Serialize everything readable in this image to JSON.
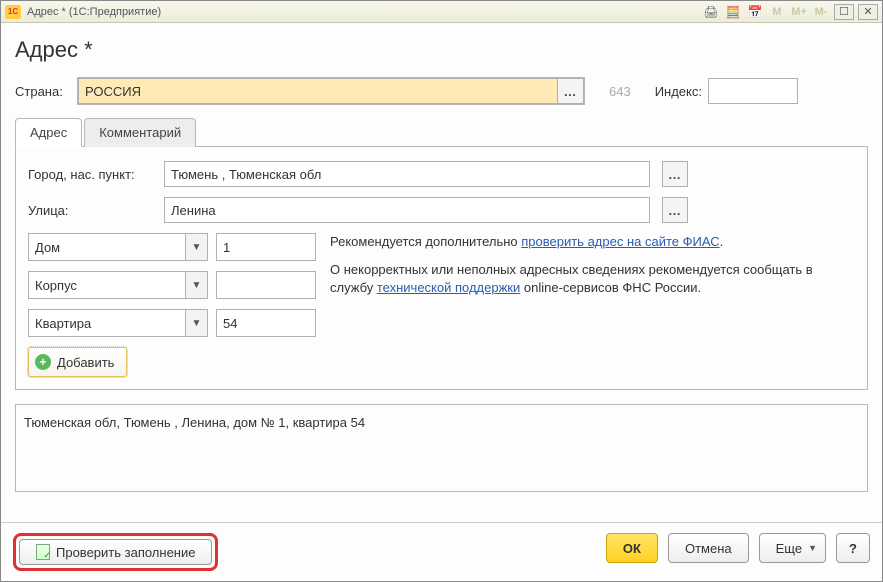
{
  "titlebar": {
    "title": "Адрес * (1С:Предприятие)",
    "logo": "1C"
  },
  "page_title": "Адрес *",
  "country": {
    "label": "Страна:",
    "value": "РОССИЯ",
    "code": "643",
    "index_label": "Индекс:",
    "index_value": ""
  },
  "tabs": {
    "address": "Адрес",
    "comment": "Комментарий"
  },
  "address": {
    "city_label": "Город, нас. пункт:",
    "city_value": "Тюмень , Тюменская обл",
    "street_label": "Улица:",
    "street_value": "Ленина",
    "parts": [
      {
        "type": "Дом",
        "value": "1"
      },
      {
        "type": "Корпус",
        "value": ""
      },
      {
        "type": "Квартира",
        "value": "54"
      }
    ],
    "hint1_pre": "Рекомендуется дополнительно ",
    "hint1_link": "проверить адрес на сайте ФИАС",
    "hint1_post": ".",
    "hint2_pre": "О некорректных или неполных адресных сведениях рекомендуется сообщать в службу ",
    "hint2_link": "технической поддержки",
    "hint2_post": " online-сервисов ФНС России.",
    "add_label": "Добавить"
  },
  "summary": "Тюменская обл, Тюмень , Ленина, дом № 1, квартира 54",
  "footer": {
    "check": "Проверить заполнение",
    "ok": "ОК",
    "cancel": "Отмена",
    "more": "Еще",
    "help": "?"
  }
}
